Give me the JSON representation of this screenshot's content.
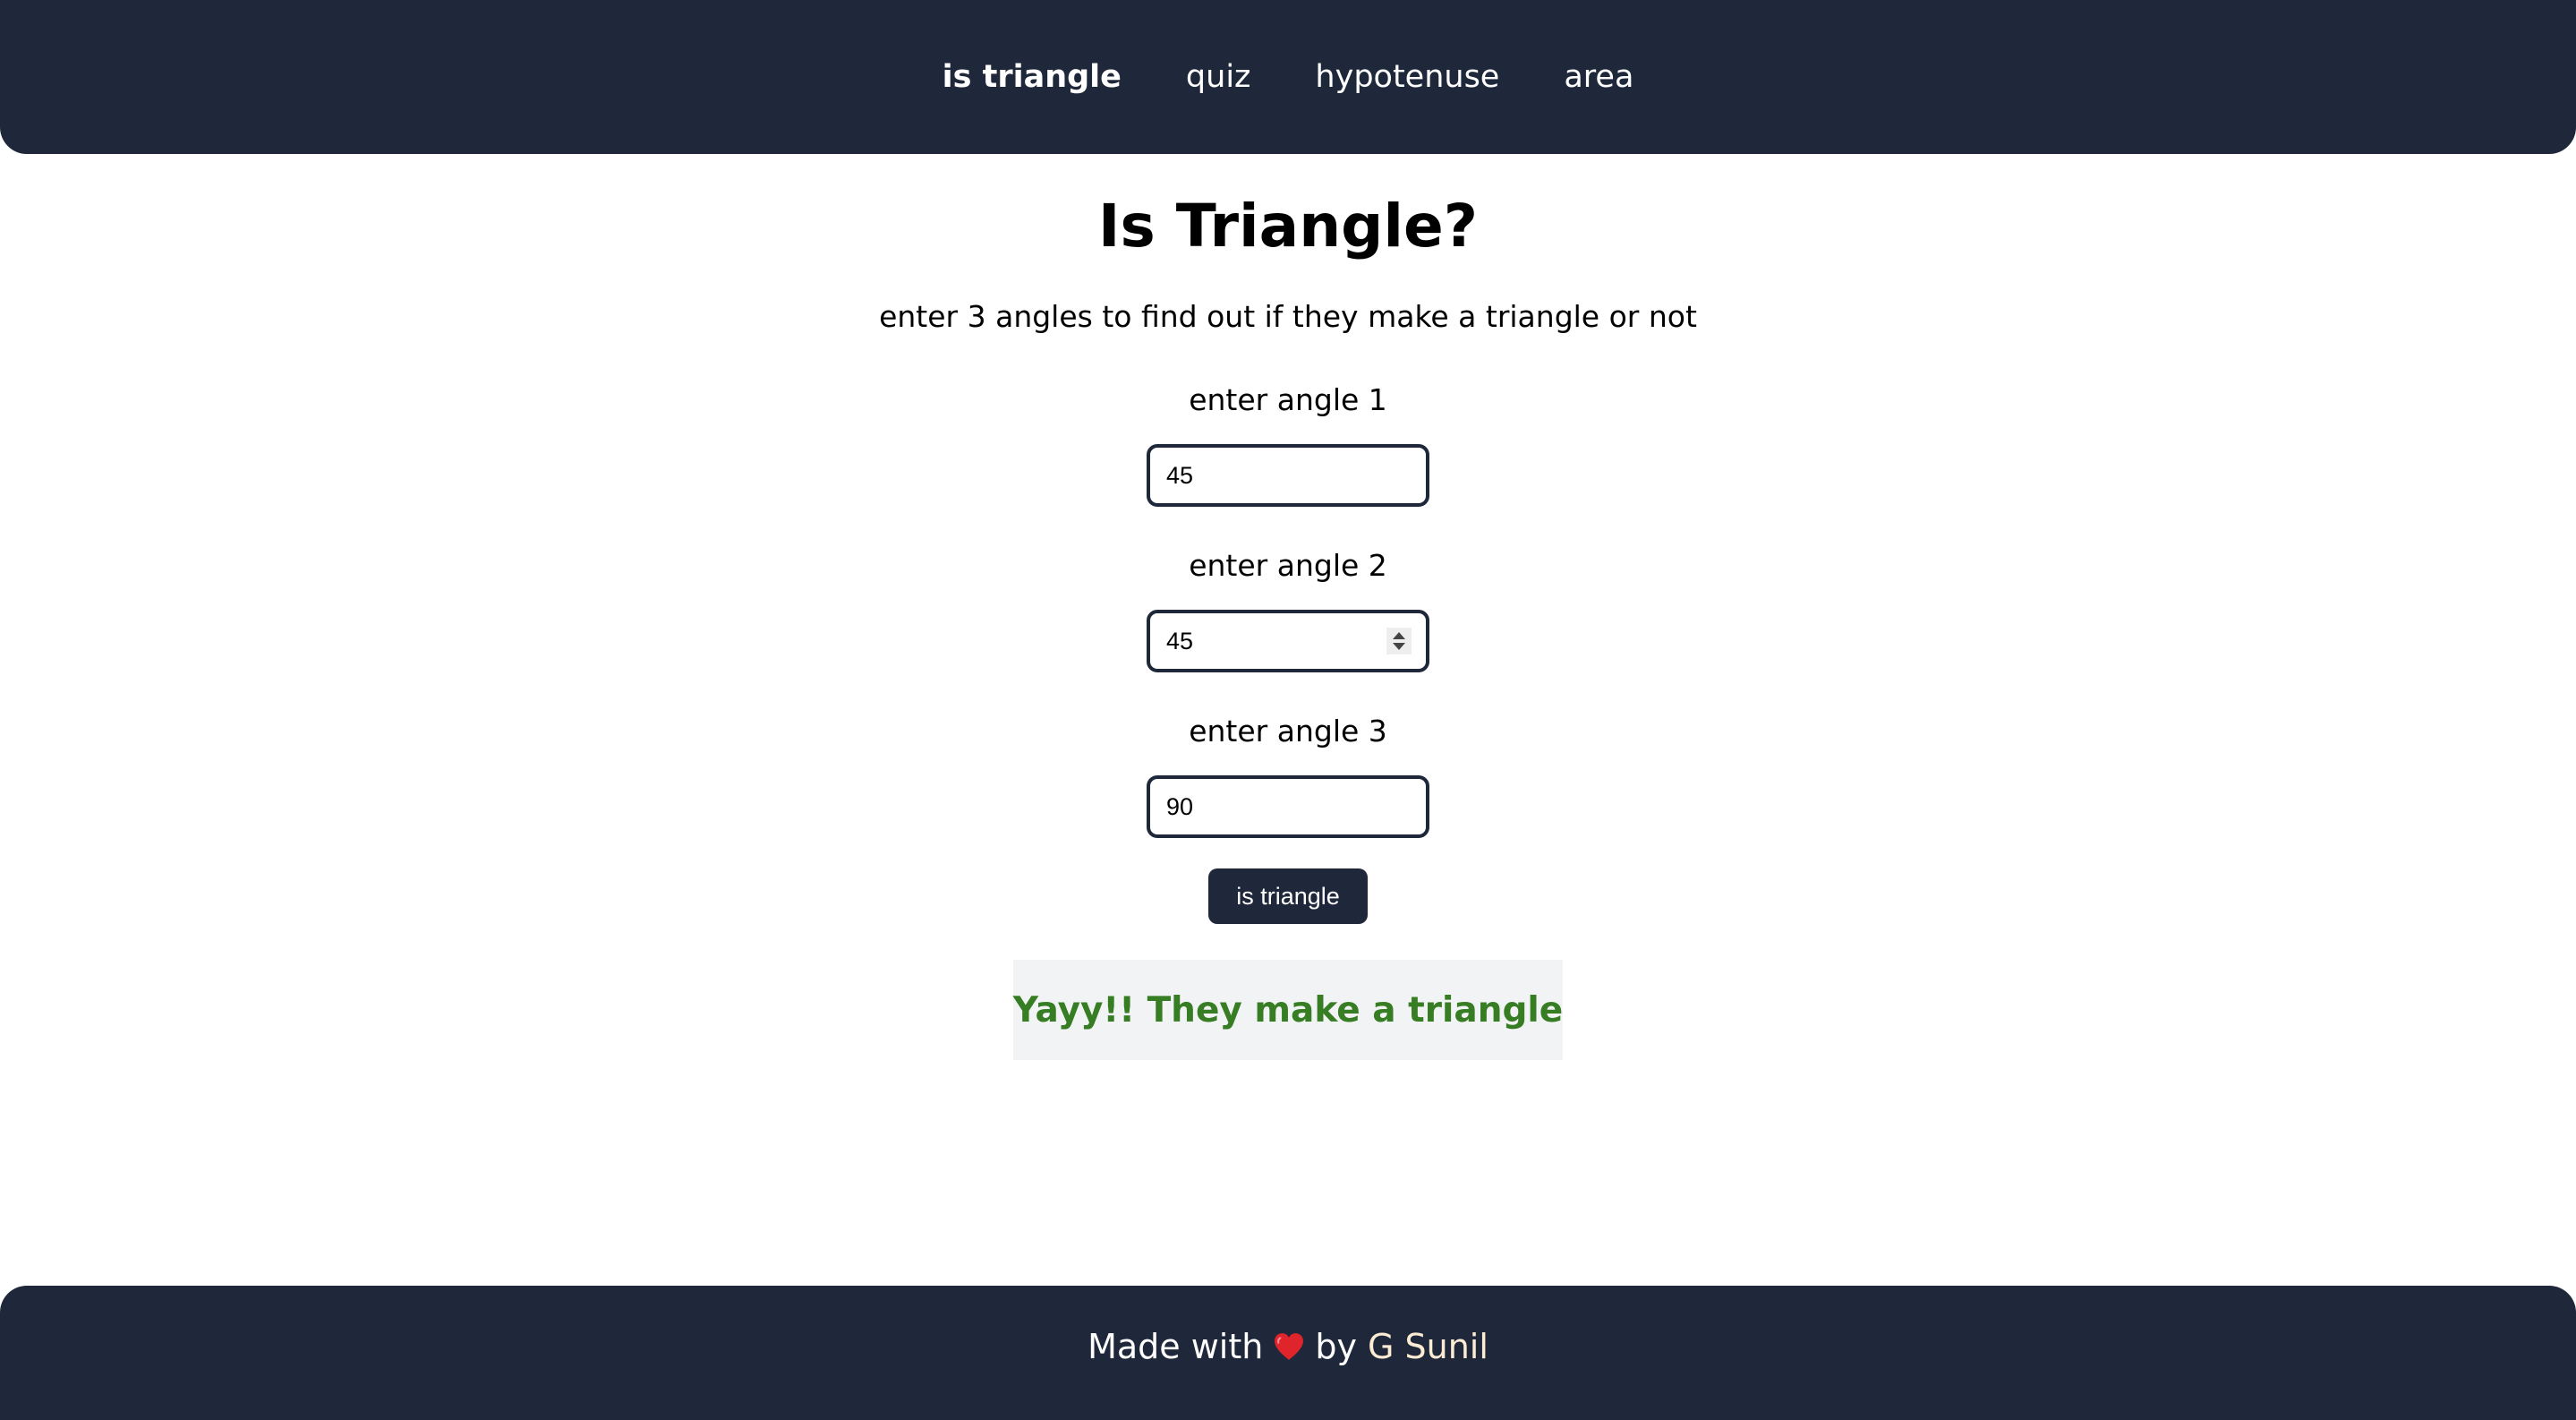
{
  "nav": {
    "items": [
      {
        "label": "is triangle",
        "active": true
      },
      {
        "label": "quiz",
        "active": false
      },
      {
        "label": "hypotenuse",
        "active": false
      },
      {
        "label": "area",
        "active": false
      }
    ]
  },
  "main": {
    "title": "Is Triangle?",
    "subtitle": "enter 3 angles to find out if they make a triangle or not",
    "fields": [
      {
        "label": "enter angle 1",
        "value": "45"
      },
      {
        "label": "enter angle 2",
        "value": "45"
      },
      {
        "label": "enter angle 3",
        "value": "90"
      }
    ],
    "button_label": "is triangle",
    "result": "Yayy!! They make a triangle"
  },
  "footer": {
    "prefix": "Made with",
    "icon": "heart-icon",
    "by": "by",
    "author": "G Sunil"
  },
  "colors": {
    "primary": "#1f283b",
    "success": "#367d23",
    "heart": "#e0242b",
    "author_link": "#fdecd4"
  }
}
